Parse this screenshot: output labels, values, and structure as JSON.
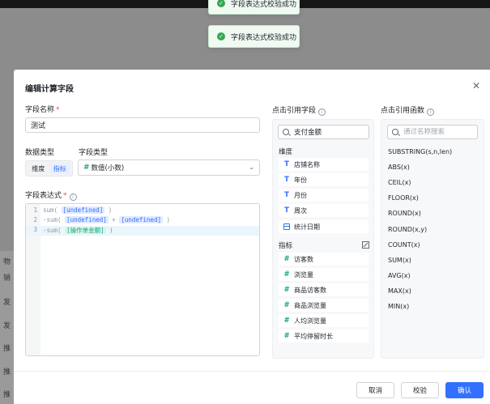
{
  "background": {
    "rows": [
      "物",
      "销",
      "发",
      "发",
      "推",
      "推",
      "推"
    ]
  },
  "toasts": [
    {
      "text": "字段表达式校验成功"
    },
    {
      "text": "字段表达式校验成功"
    }
  ],
  "dialog": {
    "title": "编辑计算字段",
    "field_name_label": "字段名称",
    "field_name_value": "测试",
    "data_type_label": "数据类型",
    "data_type_options": [
      "维度",
      "指标"
    ],
    "data_type_selected": "指标",
    "field_type_label": "字段类型",
    "field_type_value": "数值(小数)",
    "expression_label": "字段表达式",
    "expression_lines": [
      {
        "no": "1",
        "prefix": "sum(",
        "parts": [
          {
            "tag": "[undefined]",
            "style": "blue"
          }
        ],
        "suffix": ")"
      },
      {
        "no": "2",
        "prefix": "-sum(",
        "parts": [
          {
            "tag": "[undefined]",
            "style": "blue"
          },
          {
            "op": "+"
          },
          {
            "tag": "[undefined]",
            "style": "blue"
          }
        ],
        "suffix": ")"
      },
      {
        "no": "3",
        "prefix": "-sum(",
        "parts": [
          {
            "tag": "[操作单金额]",
            "style": "green"
          }
        ],
        "suffix": ")"
      }
    ],
    "fields_panel": {
      "title": "点击引用字段",
      "search_value": "支付金额",
      "dimension_label": "维度",
      "dimensions": [
        {
          "icon": "text-icon",
          "label": "店铺名称"
        },
        {
          "icon": "text-icon",
          "label": "年份"
        },
        {
          "icon": "text-icon",
          "label": "月份"
        },
        {
          "icon": "text-icon",
          "label": "周次"
        },
        {
          "icon": "calendar-icon",
          "label": "统计日期"
        }
      ],
      "measure_label": "指标",
      "measures": [
        {
          "icon": "hash-icon",
          "label": "访客数"
        },
        {
          "icon": "hash-icon",
          "label": "浏览量"
        },
        {
          "icon": "hash-icon",
          "label": "商品访客数"
        },
        {
          "icon": "hash-icon",
          "label": "商品浏览量"
        },
        {
          "icon": "hash-icon",
          "label": "人均浏览量"
        },
        {
          "icon": "hash-icon",
          "label": "平均停留时长"
        }
      ]
    },
    "functions_panel": {
      "title": "点击引用函数",
      "search_placeholder": "通过名称搜索",
      "functions": [
        "SUBSTRING(s,n,len)",
        "ABS(x)",
        "CEIL(x)",
        "FLOOR(x)",
        "ROUND(x)",
        "ROUND(x,y)",
        "COUNT(x)",
        "SUM(x)",
        "AVG(x)",
        "MAX(x)",
        "MIN(x)"
      ]
    },
    "buttons": {
      "cancel": "取消",
      "validate": "校验",
      "confirm": "确认"
    }
  }
}
